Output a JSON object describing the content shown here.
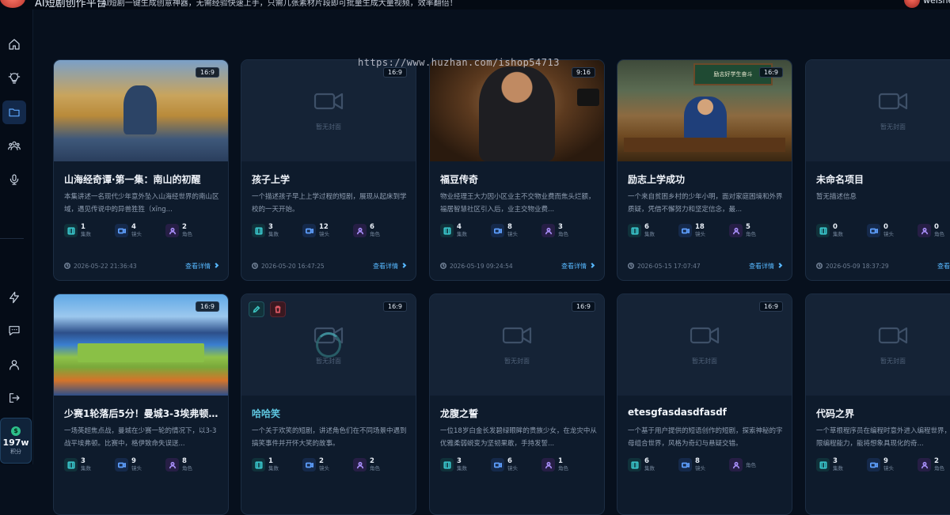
{
  "header": {
    "app_title": "AI短剧创作平台",
    "tagline": "AI短剧一键生成创意神器，无需经验快速上手，只需几张素材片段即可批量生成大量视频，效率翻倍！",
    "user_name": "weishe"
  },
  "watermark": "https://www.huzhan.com/ishop54713",
  "sidebar": {
    "items": [
      {
        "name": "home",
        "icon": "home-icon"
      },
      {
        "name": "ideas",
        "icon": "lightbulb-icon"
      },
      {
        "name": "projects",
        "icon": "folder-icon",
        "active": true
      },
      {
        "name": "characters",
        "icon": "users-icon"
      },
      {
        "name": "voice",
        "icon": "microphone-icon"
      },
      {
        "name": "quick",
        "icon": "lightning-icon"
      },
      {
        "name": "messages",
        "icon": "chat-icon"
      },
      {
        "name": "profile",
        "icon": "user-icon"
      },
      {
        "name": "logout",
        "icon": "logout-icon"
      }
    ],
    "points": {
      "value": "197w",
      "label": "积分"
    }
  },
  "labels": {
    "episodes": "集数",
    "shots": "镜头",
    "roles": "角色",
    "view_detail": "查看详情",
    "no_cover": "暂无封面"
  },
  "projects": [
    {
      "title": "山海经奇谭·第一集：南山的初醒",
      "desc": "本集讲述一名现代少年意外坠入山海经世界的南山区域，遇见传说中的异兽狌狌（xīng...",
      "ratio": "16:9",
      "episodes": "1",
      "shots": "4",
      "roles": "2",
      "date": "2026-05-22 21:36:43",
      "cover": "img1"
    },
    {
      "title": "孩子上学",
      "desc": "一个描述孩子早上上学过程的短剧，展现从起床到学校的一天开始。",
      "ratio": "16:9",
      "episodes": "3",
      "shots": "12",
      "roles": "6",
      "date": "2026-05-20 16:47:25",
      "cover": "none"
    },
    {
      "title": "福豆传奇",
      "desc": "物业经理王大力因小区业主不交物业费而焦头烂额，福居智慧社区引入后，业主交物业费...",
      "ratio": "9:16",
      "episodes": "4",
      "shots": "8",
      "roles": "3",
      "date": "2026-05-19 09:24:54",
      "cover": "img3"
    },
    {
      "title": "励志上学成功",
      "desc": "一个来自贫困乡村的少年小明，面对家庭困境和外界质疑，凭借不懈努力和坚定信念，最...",
      "ratio": "16:9",
      "episodes": "6",
      "shots": "18",
      "roles": "5",
      "date": "2026-05-15 17:07:47",
      "cover": "img4",
      "board_text": "励志好学生奋斗"
    },
    {
      "title": "未命名项目",
      "desc": "暂无描述信息",
      "ratio": "",
      "episodes": "0",
      "shots": "0",
      "roles": "0",
      "date": "2026-05-09 18:37:29",
      "cover": "none"
    },
    {
      "title": "少赛1轮落后5分！曼城3-3埃弗顿...",
      "desc": "一场英超焦点战，曼城在少赛一轮的情况下，以3-3战平埃弗顿。比赛中，格伊致命失误送...",
      "ratio": "16:9",
      "episodes": "3",
      "shots": "9",
      "roles": "8",
      "date": "",
      "cover": "img6"
    },
    {
      "title": "哈哈笑",
      "desc": "一个关于欢笑的短剧，讲述角色们在不同场景中遇到搞笑事件并开怀大笑的故事。",
      "ratio": "16:9",
      "episodes": "1",
      "shots": "2",
      "roles": "2",
      "date": "",
      "cover": "none",
      "loading": true
    },
    {
      "title": "龙腹之誓",
      "desc": "一位18岁白金长发碧绿眼眸的贵族少女，在龙灾中从优雅柔弱蜕变为坚韧果敢，手持发誓...",
      "ratio": "16:9",
      "episodes": "3",
      "shots": "6",
      "roles": "1",
      "date": "",
      "cover": "none"
    },
    {
      "title": "etesgfasdasdfasdf",
      "desc": "一个基于用户提供的短语创作的短剧，探索神秘的字母组合世界，风格为奇幻与悬疑交错。",
      "ratio": "16:9",
      "episodes": "6",
      "shots": "8",
      "roles": "",
      "date": "",
      "cover": "none"
    },
    {
      "title": "代码之界",
      "desc": "一个草根程序员在编程时意外进入编程世界，获得无限编程能力，能将想象具现化的奇...",
      "ratio": "",
      "episodes": "3",
      "shots": "9",
      "roles": "2",
      "date": "",
      "cover": "none"
    }
  ]
}
